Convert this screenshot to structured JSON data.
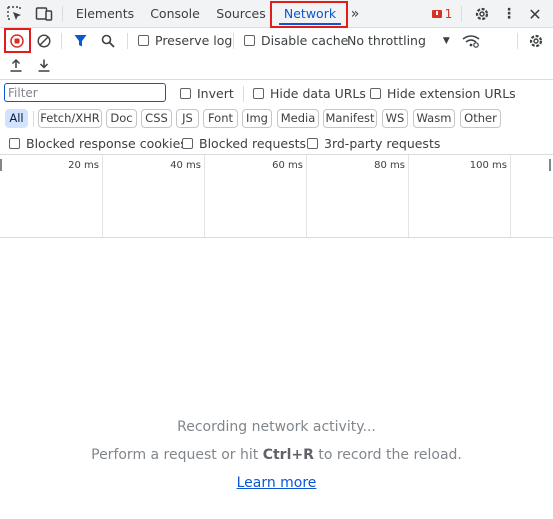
{
  "tabs": {
    "elements": "Elements",
    "console": "Console",
    "sources": "Sources",
    "network": "Network"
  },
  "issues_count": "1",
  "toolbar": {
    "preserve_log": "Preserve log",
    "disable_cache": "Disable cache",
    "throttling": "No throttling"
  },
  "filter": {
    "placeholder": "Filter",
    "invert": "Invert",
    "hide_data_urls": "Hide data URLs",
    "hide_extension_urls": "Hide extension URLs"
  },
  "types": [
    "All",
    "Fetch/XHR",
    "Doc",
    "CSS",
    "JS",
    "Font",
    "Img",
    "Media",
    "Manifest",
    "WS",
    "Wasm",
    "Other"
  ],
  "blocking": {
    "blocked_cookies": "Blocked response cookies",
    "blocked_requests": "Blocked requests",
    "third_party": "3rd-party requests"
  },
  "timeline_ticks": [
    "20 ms",
    "40 ms",
    "60 ms",
    "80 ms",
    "100 ms"
  ],
  "empty_state": {
    "recording": "Recording network activity...",
    "perform_prefix": "Perform a request or hit ",
    "shortcut_ctrl": "Ctrl",
    "shortcut_plus": "+",
    "shortcut_r": "R",
    "perform_suffix": " to record the reload.",
    "learn_more": "Learn more"
  },
  "colors": {
    "accent": "#0b57d0",
    "highlight_box": "#e21b1b",
    "record_stop": "#d93025"
  }
}
